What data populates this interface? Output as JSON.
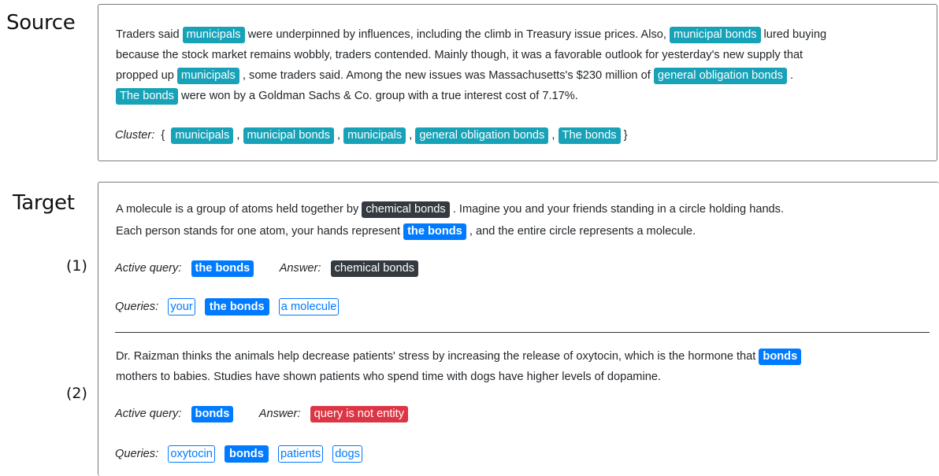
{
  "labels": {
    "source": "Source",
    "target": "Target",
    "ex1": "(1)",
    "ex2": "(2)"
  },
  "source": {
    "line1": {
      "t1": "Traders said ",
      "m1": "municipals",
      "t2": " were underpinned by influences, including the climb in Treasury issue prices. Also, ",
      "m2": "municipal bonds",
      "t3": " lured buying"
    },
    "line2": "because the stock market remains wobbly, traders contended. Mainly though, it was a favorable outlook for yesterday's new supply that",
    "line3": {
      "t1": "propped up ",
      "m3": "municipals",
      "t2": " , some traders said. Among the new issues was Massachusetts's $230  million of ",
      "m4": "general obligation bonds",
      "t3": " ."
    },
    "line4": {
      "m5": "The bonds",
      "t1": " were won by a Goldman Sachs & Co. group with a true interest cost of 7.17%."
    },
    "cluster": {
      "label": "Cluster:",
      "open": "{",
      "close": "}",
      "sep": ",",
      "items": [
        "municipals",
        "municipal bonds",
        "municipals",
        "general obligation bonds",
        "The bonds"
      ]
    }
  },
  "example1": {
    "line1": {
      "t1": "A molecule is a group of atoms held together by ",
      "answer": "chemical bonds",
      "t2": " . Imagine you and your friends standing in a circle holding hands."
    },
    "line2": {
      "t1": "Each person stands for one atom, your hands represent ",
      "query": "the bonds",
      "t2": " ,  and the entire circle represents a molecule."
    },
    "active_query_label": "Active query:",
    "active_query": "the bonds",
    "answer_label": "Answer:",
    "answer": "chemical bonds",
    "queries_label": "Queries:",
    "queries": [
      "your",
      "the bonds",
      "a molecule"
    ]
  },
  "example2": {
    "line1": {
      "t1": "Dr. Raizman thinks the animals help decrease patients' stress by increasing the release of oxytocin, which is the hormone that ",
      "query": "bonds"
    },
    "line2": "mothers to babies. Studies have shown patients who spend time with dogs have higher levels of dopamine.",
    "active_query_label": "Active query:",
    "active_query": "bonds",
    "answer_label": "Answer:",
    "answer": "query is not entity",
    "queries_label": "Queries:",
    "queries": [
      "oxytocin",
      "bonds",
      "patients",
      "dogs"
    ]
  }
}
